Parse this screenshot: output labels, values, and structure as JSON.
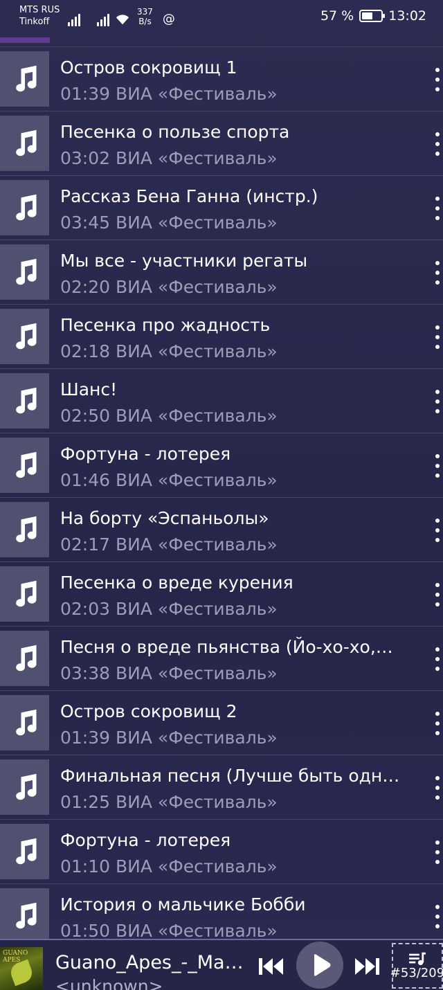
{
  "status_bar": {
    "carrier": "MTS RUS",
    "carrier2": "Tinkoff",
    "net_speed": "337",
    "net_unit": "B/s",
    "battery": "57 %",
    "battery_level": 0.57,
    "time": "13:02"
  },
  "tracks": [
    {
      "title": "Остров сокровищ 1",
      "subtitle": "01:39 ВИА «Фестиваль»"
    },
    {
      "title": "Песенка о пользе спорта",
      "subtitle": "03:02 ВИА «Фестиваль»"
    },
    {
      "title": "Рассказ Бена Ганна (инстр.)",
      "subtitle": "03:45 ВИА «Фестиваль»"
    },
    {
      "title": "Мы все - участники регаты",
      "subtitle": "02:20 ВИА «Фестиваль»"
    },
    {
      "title": "Песенка про жадность",
      "subtitle": "02:18 ВИА «Фестиваль»"
    },
    {
      "title": "Шанс!",
      "subtitle": "02:50 ВИА «Фестиваль»"
    },
    {
      "title": "Фортуна - лотерея",
      "subtitle": "01:46 ВИА «Фестиваль»"
    },
    {
      "title": "На борту «Эспаньолы»",
      "subtitle": "02:17 ВИА «Фестиваль»"
    },
    {
      "title": "Песенка о вреде курения",
      "subtitle": "02:03 ВИА «Фестиваль»"
    },
    {
      "title": "Песня о вреде пьянства (Йо-хо-хо,…",
      "subtitle": "03:38 ВИА «Фестиваль»"
    },
    {
      "title": "Остров сокровищ 2",
      "subtitle": "01:39 ВИА «Фестиваль»"
    },
    {
      "title": "Финальная песня (Лучше быть одн…",
      "subtitle": "01:25 ВИА «Фестиваль»"
    },
    {
      "title": "Фортуна - лотерея",
      "subtitle": "01:10 ВИА «Фестиваль»"
    },
    {
      "title": "История о мальчике Бобби",
      "subtitle": "01:50 ВИА «Фестиваль»"
    }
  ],
  "player": {
    "title": "Guano_Apes_-_Ma…",
    "artist": "<unknown>",
    "album_art_text": "GUANO APES",
    "queue": "#53/209"
  },
  "icons": {
    "thumb": "music-note-icon",
    "menu": "more-vertical-icon",
    "prev": "skip-previous-icon",
    "play": "play-icon",
    "next": "skip-next-icon",
    "queue": "queue-music-icon"
  },
  "colors": {
    "background": "#2b2b4f",
    "thumb_bg": "#505070",
    "subtitle": "#9d9db8",
    "divider": "#44446a"
  }
}
